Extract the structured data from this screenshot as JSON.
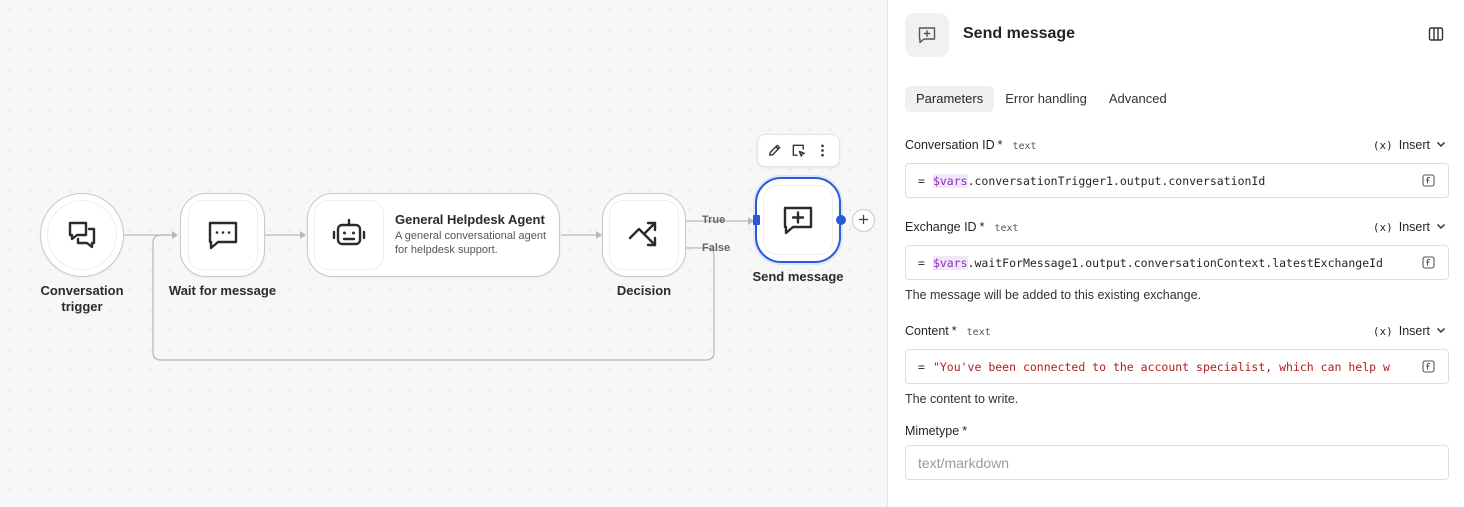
{
  "canvas": {
    "nodes": {
      "conversation_trigger": {
        "label": "Conversation trigger",
        "icon": "chat-bubbles-icon"
      },
      "wait_for_message": {
        "label": "Wait for message",
        "icon": "message-dots-icon"
      },
      "agent": {
        "title": "General Helpdesk Agent",
        "description": "A general conversational agent for helpdesk support.",
        "icon": "robot-icon"
      },
      "decision": {
        "label": "Decision",
        "icon": "branch-arrows-icon"
      },
      "send_message": {
        "label": "Send message",
        "icon": "message-plus-icon"
      }
    },
    "edges": {
      "true_label": "True",
      "false_label": "False"
    },
    "toolbar": {
      "icons": [
        "pencil-icon",
        "select-icon",
        "more-vertical-icon"
      ]
    }
  },
  "panel": {
    "title": "Send message",
    "tabs": [
      "Parameters",
      "Error handling",
      "Advanced"
    ],
    "active_tab": "Parameters",
    "insert_label": "Insert",
    "fields": {
      "conversation_id": {
        "label": "Conversation ID",
        "required": "*",
        "type": "text",
        "var": "$vars",
        "rest": ".conversationTrigger1.output.conversationId"
      },
      "exchange_id": {
        "label": "Exchange ID",
        "required": "*",
        "type": "text",
        "var": "$vars",
        "rest": ".waitForMessage1.output.conversationContext.latestExchangeId",
        "help": "The message will be added to this existing exchange."
      },
      "content": {
        "label": "Content",
        "required": "*",
        "type": "text",
        "value": "\"You've been connected to the account specialist, which can help w",
        "help": "The content to write."
      },
      "mimetype": {
        "label": "Mimetype",
        "required": "*",
        "placeholder": "text/markdown"
      }
    },
    "expression_prefix": "="
  },
  "colors": {
    "accent": "#2a5bd7",
    "var_color": "#8a2fb5",
    "string_color": "#b21d1d"
  }
}
